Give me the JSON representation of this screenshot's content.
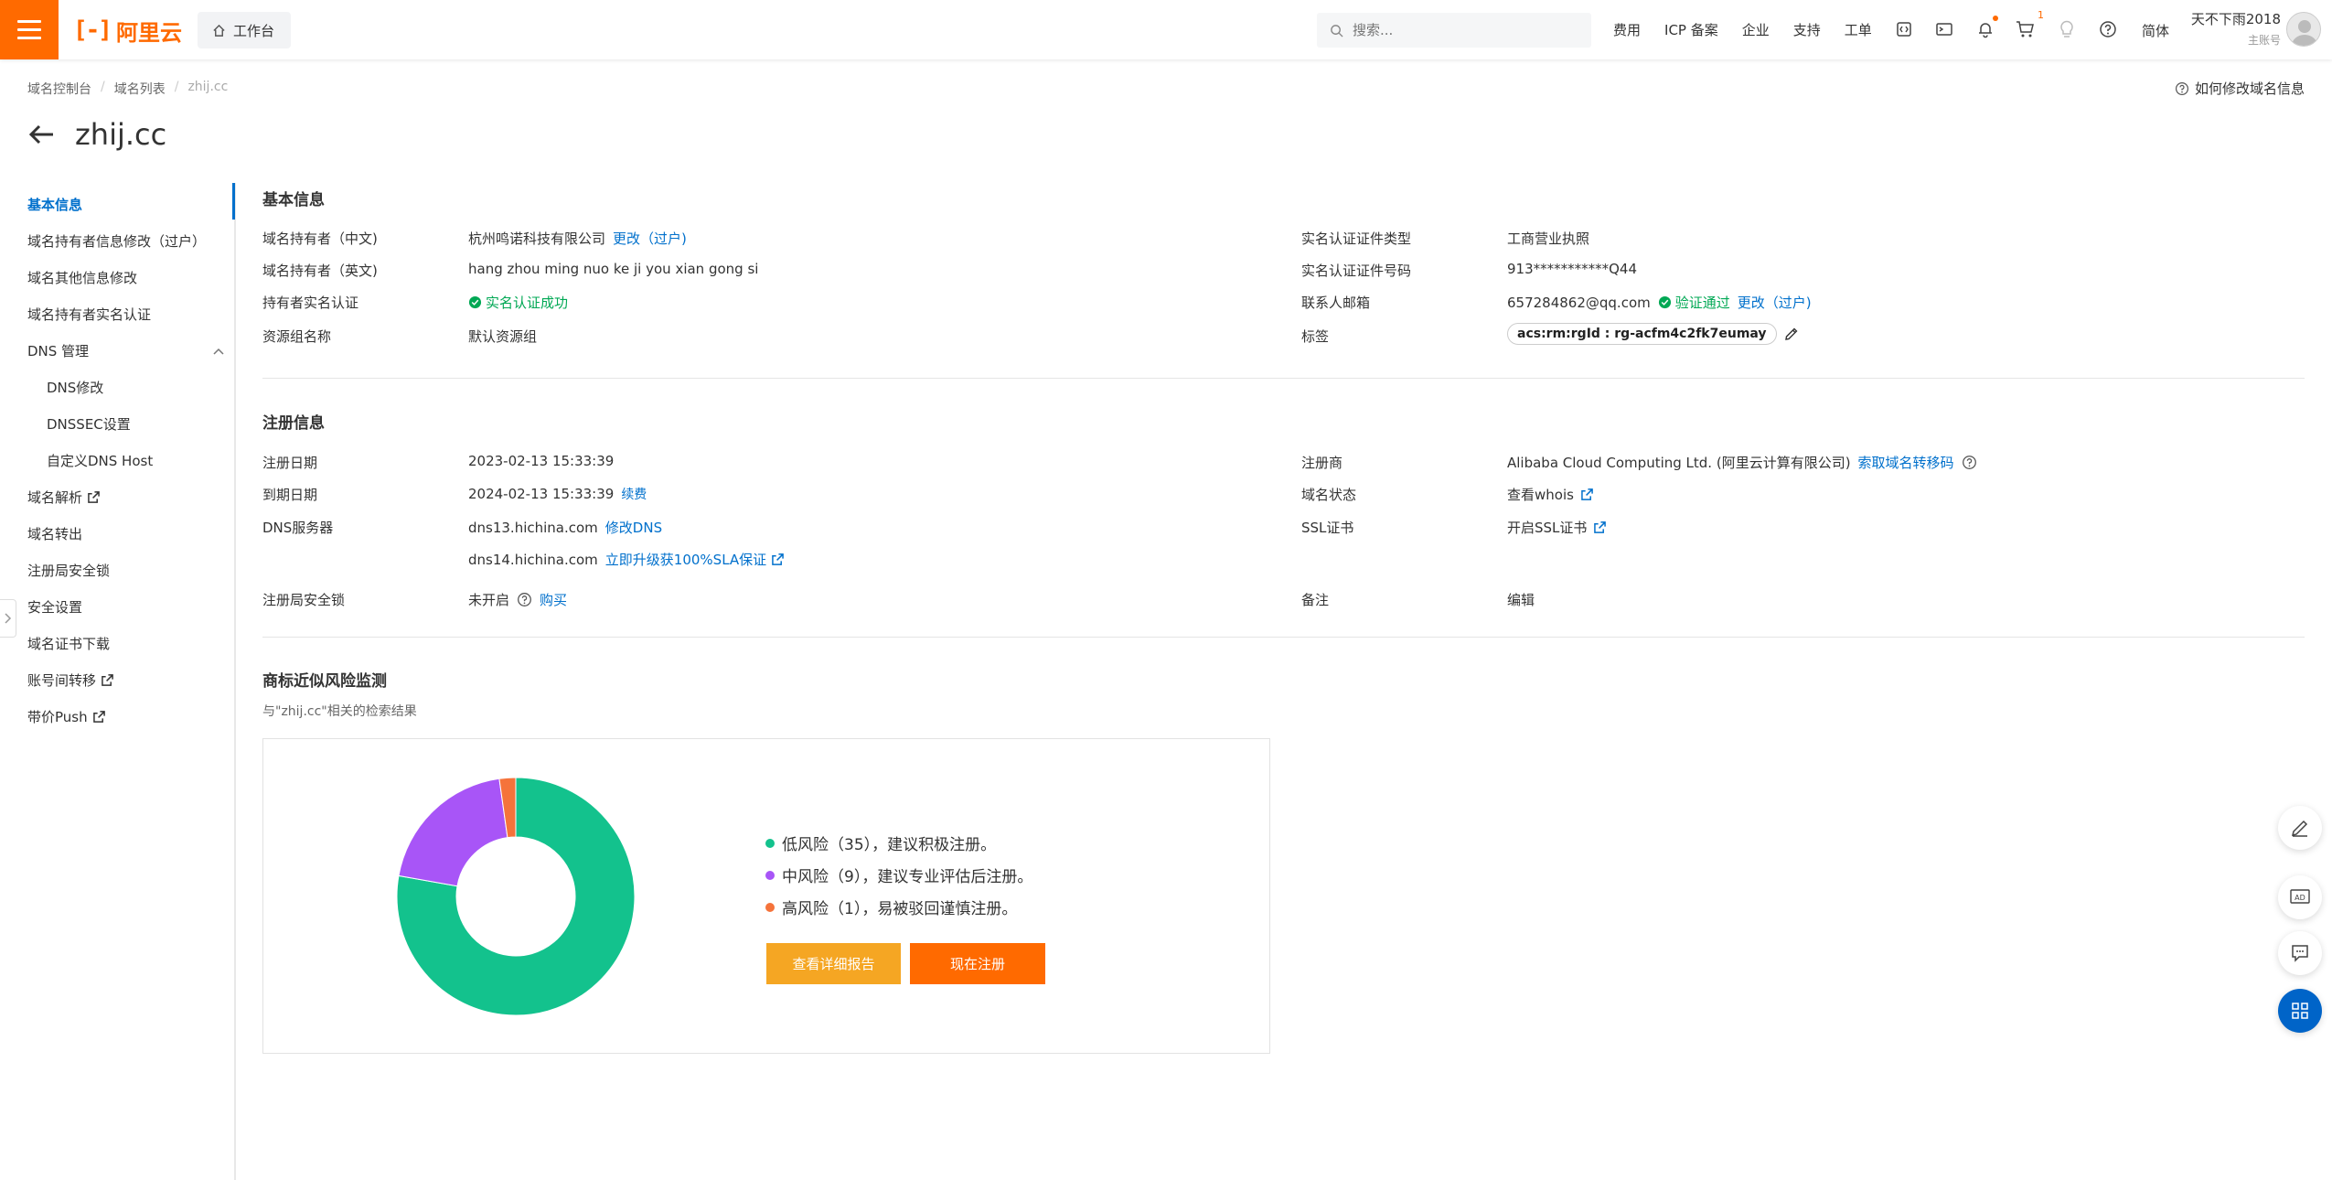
{
  "topbar": {
    "logo_text": "阿里云",
    "workbench": "工作台",
    "search_placeholder": "搜索...",
    "links": [
      "费用",
      "ICP 备案",
      "企业",
      "支持",
      "工单"
    ],
    "cart_count": "1",
    "lang": "简体",
    "user_name": "天不下雨2018",
    "user_role": "主账号",
    "accent": "#ff6a00"
  },
  "breadcrumb": [
    "域名控制台",
    "域名列表",
    "zhij.cc"
  ],
  "help_link": "如何修改域名信息",
  "page_title": "zhij.cc",
  "sidebar": {
    "items": [
      "基本信息",
      "域名持有者信息修改（过户）",
      "域名其他信息修改",
      "域名持有者实名认证",
      "DNS 管理",
      "DNS修改",
      "DNSSEC设置",
      "自定义DNS Host",
      "域名解析",
      "域名转出",
      "注册局安全锁",
      "安全设置",
      "域名证书下载",
      "账号间转移",
      "带价Push"
    ]
  },
  "basic": {
    "title": "基本信息",
    "holder_cn_label": "域名持有者（中文)",
    "holder_cn_value": "杭州鸣诺科技有限公司",
    "holder_cn_link": "更改（过户)",
    "holder_en_label": "域名持有者（英文)",
    "holder_en_value": "hang zhou ming nuo ke ji you xian gong si",
    "auth_label": "持有者实名认证",
    "auth_value": "实名认证成功",
    "rg_label": "资源组名称",
    "rg_value": "默认资源组",
    "cert_type_label": "实名认证证件类型",
    "cert_type_value": "工商营业执照",
    "cert_no_label": "实名认证证件号码",
    "cert_no_value": "913***********Q44",
    "email_label": "联系人邮箱",
    "email_value": "657284862@qq.com",
    "email_status": "验证通过",
    "email_link": "更改（过户)",
    "tag_label": "标签",
    "tag_value": "acs:rm:rgId : rg-acfm4c2fk7eumay"
  },
  "registration": {
    "title": "注册信息",
    "reg_date_label": "注册日期",
    "reg_date_value": "2023-02-13 15:33:39",
    "exp_date_label": "到期日期",
    "exp_date_value": "2024-02-13 15:33:39",
    "renew_link": "续费",
    "dns_label": "DNS服务器",
    "dns1": "dns13.hichina.com",
    "dns1_link": "修改DNS",
    "dns2": "dns14.hichina.com",
    "dns2_link": "立即升级获100%SLA保证",
    "lock_label": "注册局安全锁",
    "lock_value": "未开启",
    "lock_link": "购买",
    "registrar_label": "注册商",
    "registrar_value": "Alibaba Cloud Computing Ltd. (阿里云计算有限公司)",
    "transfer_code_link": "索取域名转移码",
    "status_label": "域名状态",
    "whois_link": "查看whois",
    "ssl_label": "SSL证书",
    "ssl_link": "开启SSL证书",
    "remark_label": "备注",
    "remark_link": "编辑"
  },
  "trademark": {
    "title": "商标近似风险监测",
    "subtitle": "与\"zhij.cc\"相关的检索结果",
    "legend": [
      {
        "text": "低风险（35），建议积极注册。",
        "color": "#13c28d"
      },
      {
        "text": "中风险（9），建议专业评估后注册。",
        "color": "#a855f7"
      },
      {
        "text": "高风险（1），易被驳回谨慎注册。",
        "color": "#f5733b"
      }
    ],
    "report_button": "查看详细报告",
    "register_button": "现在注册"
  },
  "chart_data": {
    "type": "pie",
    "categories": [
      "低风险",
      "中风险",
      "高风险"
    ],
    "values": [
      35,
      9,
      1
    ],
    "colors": [
      "#13c28d",
      "#a855f7",
      "#f5733b"
    ],
    "donut": true
  }
}
